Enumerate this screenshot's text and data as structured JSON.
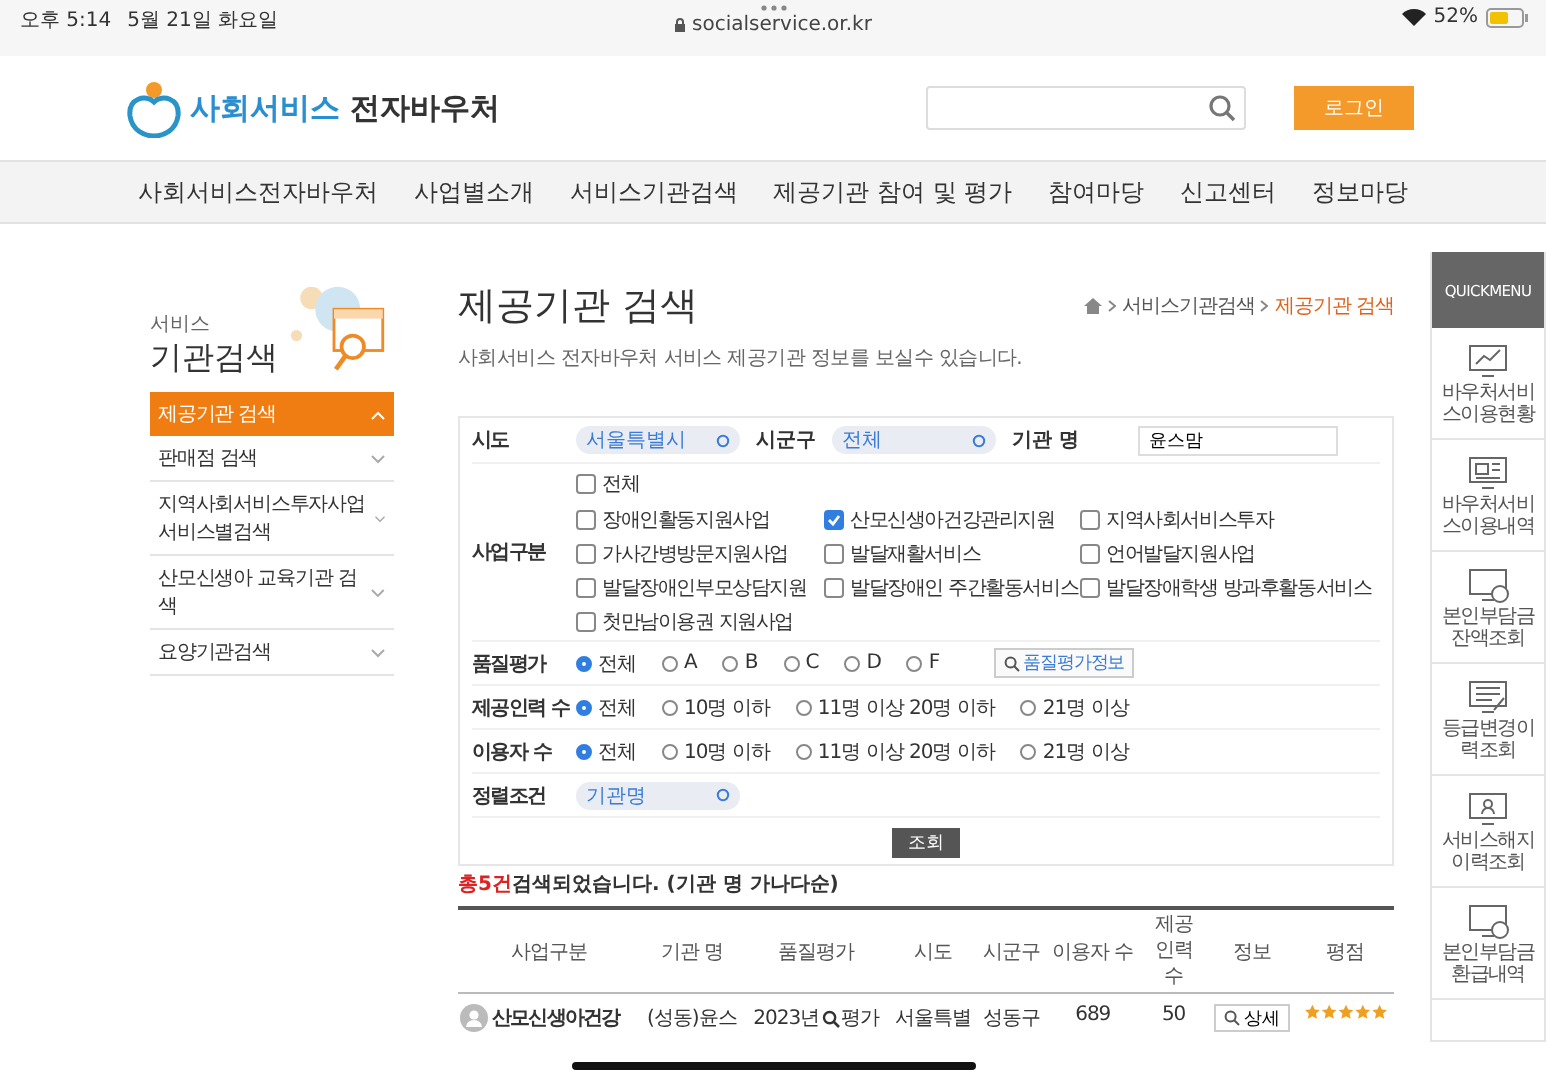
{
  "status_bar": {
    "time": "오후 5:14",
    "date": "5월 21일 화요일",
    "url": "socialservice.or.kr",
    "battery": "52%"
  },
  "header": {
    "logo_primary": "사회서비스",
    "logo_secondary": "전자바우처",
    "login_button": "로그인"
  },
  "nav": [
    "사회서비스전자바우처",
    "사업별소개",
    "서비스기관검색",
    "제공기관 참여 및 평가",
    "참여마당",
    "신고센터",
    "정보마당"
  ],
  "sidebar": {
    "title_small": "서비스",
    "title": "기관검색",
    "items": [
      {
        "label": "제공기관 검색",
        "selected": true
      },
      {
        "label": "판매점 검색",
        "selected": false
      },
      {
        "label": "지역사회서비스투자사업서비스별검색",
        "selected": false
      },
      {
        "label": "산모신생아 교육기관 검색",
        "selected": false
      },
      {
        "label": "요양기관검색",
        "selected": false
      }
    ]
  },
  "page": {
    "title": "제공기관 검색",
    "subtitle": "사회서비스 전자바우처 서비스 제공기관 정보를 보실수 있습니다.",
    "breadcrumb": [
      {
        "label": "서비스기관검색",
        "selected": false
      },
      {
        "label": "제공기관 검색",
        "selected": true
      }
    ]
  },
  "form": {
    "sido": {
      "label": "시도",
      "value": "서울특별시"
    },
    "sigungu": {
      "label": "시군구",
      "value": "전체"
    },
    "org_name": {
      "label": "기관 명",
      "value": "윤스맘"
    },
    "business": {
      "label": "사업구분",
      "all": {
        "label": "전체",
        "checked": false
      },
      "options": [
        {
          "label": "장애인활동지원사업",
          "checked": false
        },
        {
          "label": "산모신생아건강관리지원",
          "checked": true
        },
        {
          "label": "지역사회서비스투자",
          "checked": false
        },
        {
          "label": "가사간병방문지원사업",
          "checked": false
        },
        {
          "label": "발달재활서비스",
          "checked": false
        },
        {
          "label": "언어발달지원사업",
          "checked": false
        },
        {
          "label": "발달장애인부모상담지원",
          "checked": false
        },
        {
          "label": "발달장애인 주간활동서비스",
          "checked": false
        },
        {
          "label": "발달장애학생 방과후활동서비스",
          "checked": false
        },
        {
          "label": "첫만남이용권 지원사업",
          "checked": false
        }
      ]
    },
    "radio_rows": [
      {
        "label": "품질평가",
        "options": [
          {
            "label": "전체",
            "selected": true
          },
          {
            "label": "A",
            "selected": false
          },
          {
            "label": "B",
            "selected": false
          },
          {
            "label": "C",
            "selected": false
          },
          {
            "label": "D",
            "selected": false
          },
          {
            "label": "F",
            "selected": false
          }
        ],
        "button": "품질평가정보"
      },
      {
        "label": "제공인력 수",
        "options": [
          {
            "label": "전체",
            "selected": true
          },
          {
            "label": "10명 이하",
            "selected": false
          },
          {
            "label": "11명 이상 20명 이하",
            "selected": false
          },
          {
            "label": "21명 이상",
            "selected": false
          }
        ]
      },
      {
        "label": "이용자 수",
        "options": [
          {
            "label": "전체",
            "selected": true
          },
          {
            "label": "10명 이하",
            "selected": false
          },
          {
            "label": "11명 이상 20명 이하",
            "selected": false
          },
          {
            "label": "21명 이상",
            "selected": false
          }
        ]
      }
    ],
    "sort": {
      "label": "정렬조건",
      "value": "기관명"
    },
    "search_button": "조회"
  },
  "result": {
    "count": "총5건",
    "text": "검색되었습니다. (기관 명 가나다순)"
  },
  "table": {
    "columns": [
      "사업구분",
      "기관 명",
      "품질평가",
      "시도",
      "시군구",
      "이용자 수",
      "제공인력 수",
      "정보",
      "평점"
    ],
    "rows": [
      {
        "business": "산모신생아건강",
        "name": "(성동)윤스",
        "quality_year": "2023년",
        "quality_link": "평가",
        "sido": "서울특별",
        "sigungu": "성동구",
        "users": "689",
        "staff": "50",
        "info_button": "상세",
        "stars": 5
      }
    ]
  },
  "quickmenu": {
    "title": "QUICKMENU",
    "items": [
      "바우처서비스이용현황",
      "바우처서비스이용내역",
      "본인부담금잔액조회",
      "등급변경이력조회",
      "서비스해지이력조회",
      "본인부담금환급내역"
    ]
  }
}
